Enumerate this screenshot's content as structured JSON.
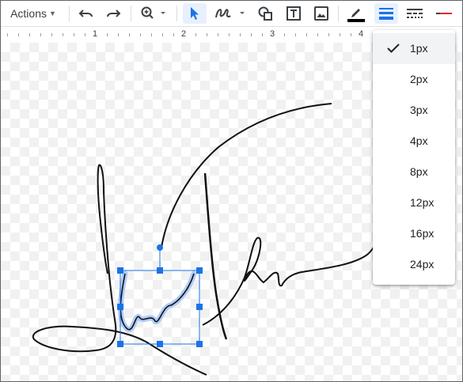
{
  "toolbar": {
    "actions_label": "Actions",
    "icons": [
      "undo-icon",
      "redo-icon",
      "zoom-icon",
      "select-icon",
      "scribble-icon",
      "shape-icon",
      "text-box-icon",
      "image-icon",
      "line-color-icon",
      "line-weight-icon",
      "line-dash-icon",
      "arrow-style-icon"
    ],
    "line_color": "#000000",
    "accent": "#1a73e8"
  },
  "ruler": {
    "numbers": [
      "1",
      "2",
      "3",
      "4"
    ]
  },
  "line_weight_menu": {
    "selected": "1px",
    "items": [
      "1px",
      "2px",
      "3px",
      "4px",
      "8px",
      "12px",
      "16px",
      "24px"
    ]
  }
}
